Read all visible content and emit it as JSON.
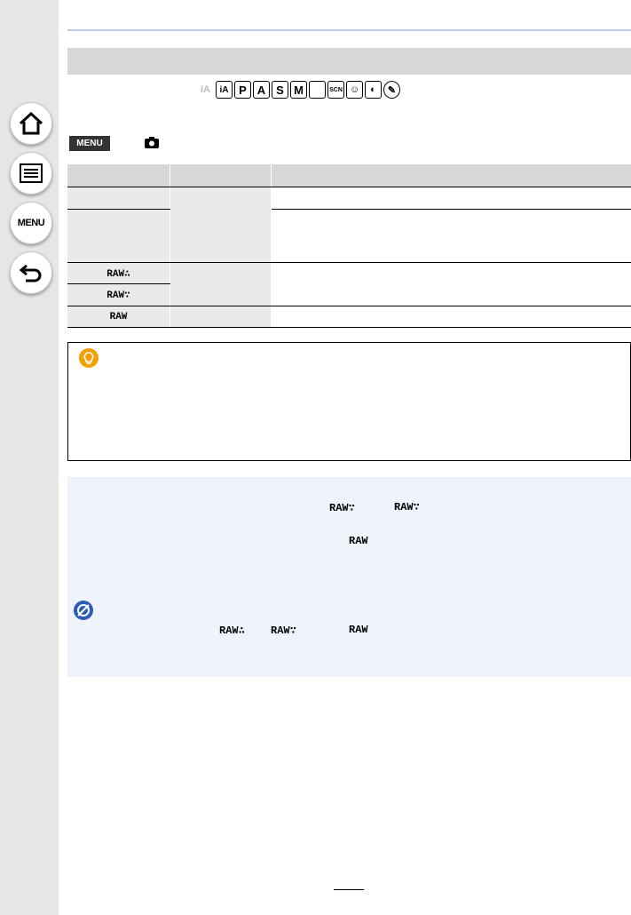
{
  "sidebar": {
    "buttons": [
      {
        "name": "home",
        "icon": "home-icon"
      },
      {
        "name": "contents",
        "icon": "list-icon"
      },
      {
        "name": "menu",
        "icon": "menu-icon",
        "label": "MENU"
      },
      {
        "name": "back",
        "icon": "back-arrow-icon"
      }
    ]
  },
  "modes": [
    "iA",
    "iA+",
    "P",
    "A",
    "S",
    "M",
    "Panorama",
    "SCN",
    "Child",
    "Portrait",
    "Creative"
  ],
  "menu_path": {
    "badge": "MENU",
    "camera_icon": "camera-icon"
  },
  "table": {
    "header": [
      "",
      "",
      ""
    ],
    "rows": [
      {
        "c1": "",
        "c2": "",
        "c3": ""
      },
      {
        "c1": "",
        "c2": "",
        "c3": ""
      },
      {
        "c1": "RAW∴",
        "c2": "",
        "c3": ""
      },
      {
        "c1": "RAW∵",
        "c2": "",
        "c3": ""
      },
      {
        "c1": "RAW",
        "c2": "",
        "c3": ""
      }
    ]
  },
  "notes": {
    "raw_fine": "RAW∴",
    "raw_std": "RAW∵",
    "raw": "RAW"
  },
  "colors": {
    "sidebar": "#e6e6e6",
    "header_bar": "#d7d7d7",
    "note_bg": "#eef3fc",
    "tip_bulb": "#f2a000",
    "not_available": "#2b5cb8"
  }
}
